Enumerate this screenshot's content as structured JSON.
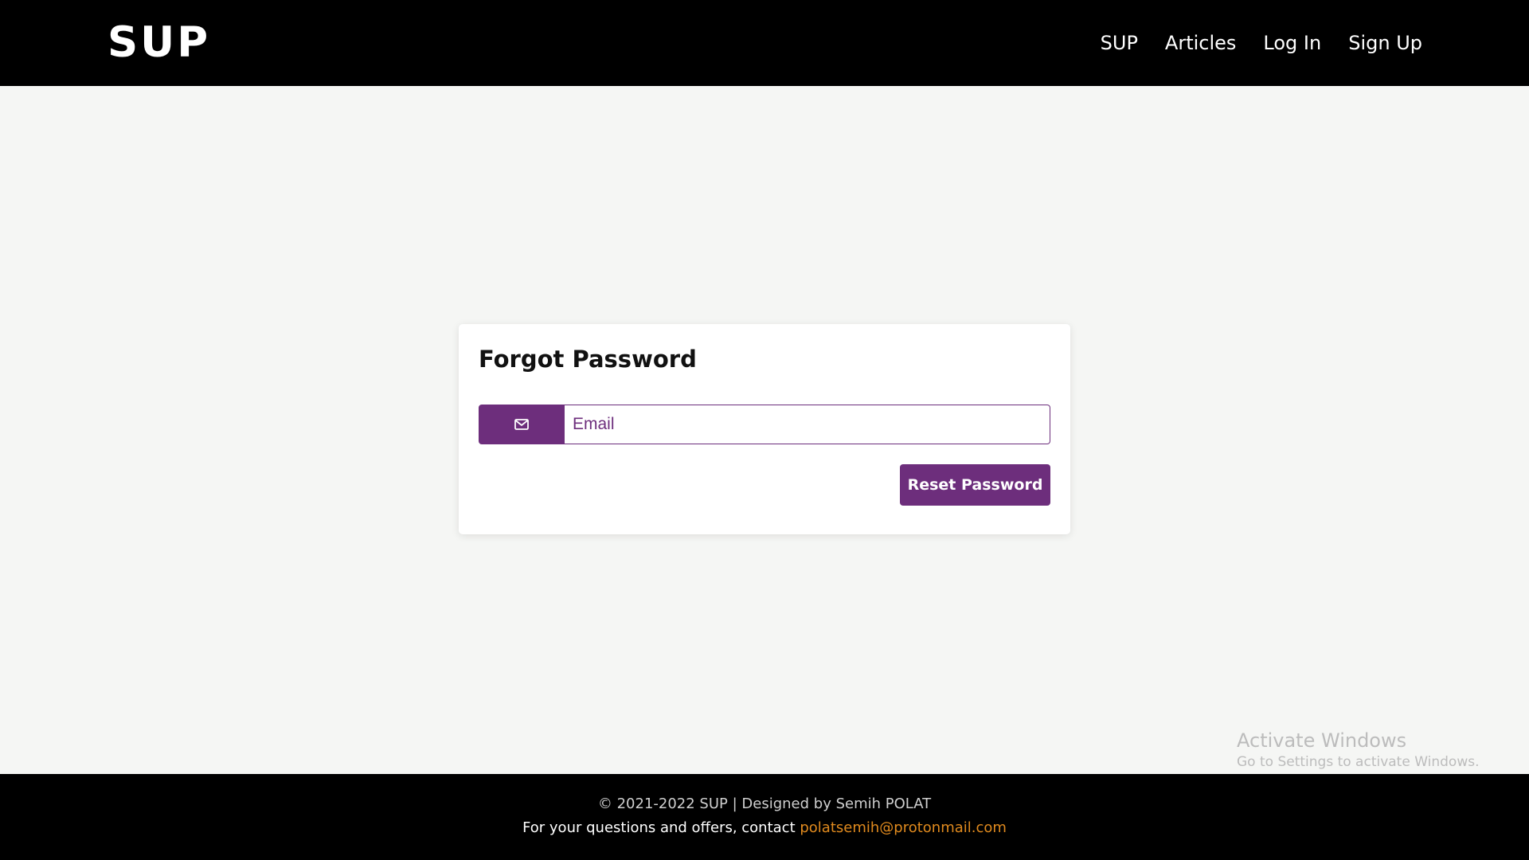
{
  "header": {
    "brand": "SUP",
    "nav": [
      {
        "label": "SUP"
      },
      {
        "label": "Articles"
      },
      {
        "label": "Log In"
      },
      {
        "label": "Sign Up"
      }
    ]
  },
  "form": {
    "title": "Forgot Password",
    "email_icon": "envelope-icon",
    "email_placeholder": "Email",
    "email_value": "",
    "reset_label": "Reset Password"
  },
  "footer": {
    "copyright": "© 2021-2022 SUP | Designed by Semih POLAT",
    "contact_prefix": "For your questions and offers, contact",
    "contact_email": "polatsemih@protonmail.com"
  },
  "watermark": {
    "title": "Activate Windows",
    "subtitle": "Go to Settings to activate Windows."
  },
  "colors": {
    "accent": "#6d2e7c",
    "header_bg": "#000000",
    "page_bg": "#f5f6f4",
    "link_email": "#e08a1e"
  }
}
